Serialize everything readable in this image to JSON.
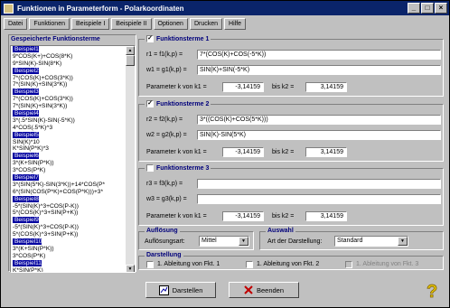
{
  "window": {
    "title": "Funktionen in Parameterform - Polarkoordinaten"
  },
  "menu": [
    "Datei",
    "Funktionen",
    "Beispiele I",
    "Beispiele II",
    "Optionen",
    "Drucken",
    "Hilfe"
  ],
  "left": {
    "title": "Gespeicherte Funktionsterme",
    "items": [
      {
        "text": "Beispiel1",
        "highlight": true
      },
      {
        "text": "9*COS(K+)+COS(8*K)"
      },
      {
        "text": "9*SIN(K)-SIN(8*K)"
      },
      {
        "text": "Beispiel2",
        "highlight": true
      },
      {
        "text": "7*(COS(K)+COS(3*K))"
      },
      {
        "text": "7*(SIN(K)+SIN(3*K))"
      },
      {
        "text": "Beispiel3",
        "highlight": true
      },
      {
        "text": "7*(COS(K)+COS(3*K))"
      },
      {
        "text": "7*(SIN(K)+SIN(3*K))"
      },
      {
        "text": "Beispiel4",
        "highlight": true
      },
      {
        "text": "3*(.5*SIN(K)-SIN(-5*K))"
      },
      {
        "text": "4*COS(.5*K)^3"
      },
      {
        "text": "Beispiel5",
        "highlight": true
      },
      {
        "text": "SIN(K)*10"
      },
      {
        "text": "K*SIN(P*K)*3"
      },
      {
        "text": "Beispiel6",
        "highlight": true
      },
      {
        "text": "3*(K+SIN(P*K))"
      },
      {
        "text": "3*COS(P*K)"
      },
      {
        "text": "Beispiel7",
        "highlight": true
      },
      {
        "text": "3*(SIN(5*K)-SIN(3*K))+14*COS(P*"
      },
      {
        "text": "6*(SIN(COS(P*K)+COS(P*K)))+3*"
      },
      {
        "text": "Beispiel8",
        "highlight": true
      },
      {
        "text": "-5*(SIN(K)^3+COS(P-K))"
      },
      {
        "text": "5*(COS(K)^3+SIN(P+K))"
      },
      {
        "text": "Beispiel9",
        "highlight": true
      },
      {
        "text": "-5*(SIN(K)^3+COS(P-K))"
      },
      {
        "text": "5*(COS(K)^3+SIN(P+K))"
      },
      {
        "text": "Beispiel10",
        "highlight": true
      },
      {
        "text": "3*(K+SIN(P*K))"
      },
      {
        "text": "3*COS(P*K)"
      },
      {
        "text": "Beispiel11",
        "highlight": true
      },
      {
        "text": "K*SIN(P*K)"
      }
    ]
  },
  "f1": {
    "title": "Funktionsterme 1",
    "checked": true,
    "r_label": "r1 = f1(k,p) =",
    "r_value": "7*(COS(K)+COS(-5*K))",
    "w_label": "w1 = g1(k,p) =",
    "w_value": "SIN(K)+SIN(-5*K)",
    "param_label": "Parameter k von k1 =",
    "k1": "-3,14159",
    "bis_label": "bis k2 =",
    "k2": "3,14159"
  },
  "f2": {
    "title": "Funktionsterme 2",
    "checked": true,
    "r_label": "r2 = f2(k,p) =",
    "r_value": "3*((COS(K)+COS(5*K)))",
    "w_label": "w2 = g2(k,p) =",
    "w_value": "SIN(K)-SIN(5*K)",
    "param_label": "Parameter k von k1 =",
    "k1": "-3,14159",
    "bis_label": "bis k2 =",
    "k2": "3,14159"
  },
  "f3": {
    "title": "Funktionsterme 3",
    "checked": false,
    "r_label": "r3 = f3(k,p) =",
    "r_value": "",
    "w_label": "w3 = g3(k,p) =",
    "w_value": "",
    "param_label": "Parameter k von k1 =",
    "k1": "-3,14159",
    "bis_label": "bis k2 =",
    "k2": "3,14159"
  },
  "aufloesung": {
    "title": "Auflösung",
    "label": "Auflösungsart:",
    "value": "Mittel"
  },
  "auswahl": {
    "title": "Auswahl",
    "label": "Art der Darstellung:",
    "value": "Standard"
  },
  "darstellung": {
    "title": "Darstellung",
    "opts": [
      "1. Ableitung von Fkt. 1",
      "1. Ableitung von Fkt. 2",
      "1. Ableitung von Fkt. 3"
    ]
  },
  "buttons": {
    "darstellen": "Darstellen",
    "beenden": "Beenden"
  },
  "colors": {
    "title_bar": "#0a246a",
    "heading": "#00007b",
    "highlight": "#0000a0"
  }
}
